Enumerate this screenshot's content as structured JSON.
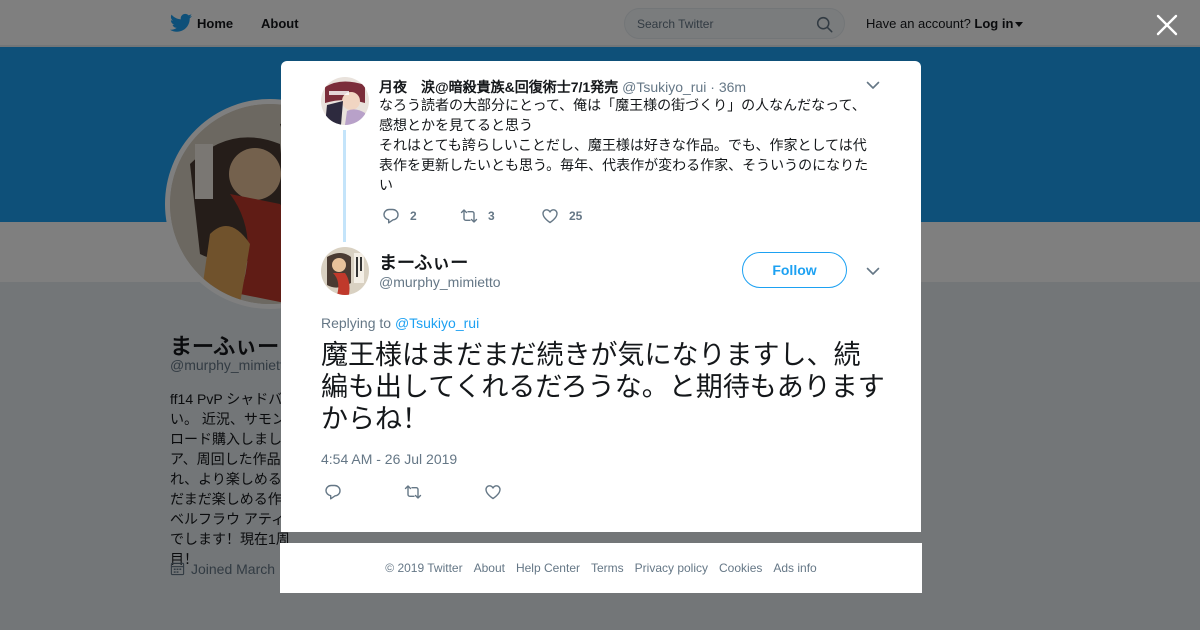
{
  "topnav": {
    "home": "Home",
    "about": "About",
    "search_placeholder": "Search Twitter",
    "have_account": "Have an account?",
    "login": "Log in"
  },
  "profile": {
    "name": "まーふぃー",
    "handle": "@murphy_mimietto",
    "bio": "ff14 PvP シャドバ\nい。 近況、サモン\nロード購入しまし\nア、周回した作品\nれ、より楽しめる\nだまだ楽しめる作\nベルフラウ アティ\nでします！現在1周目！",
    "joined": "Joined March"
  },
  "parent_tweet": {
    "name": "月夜　涙@暗殺貴族&回復術士7/1発売",
    "handle": "@Tsukiyo_rui",
    "time": "· 36m",
    "text": "なろう読者の大部分にとって、俺は「魔王様の街づくり」の人なんだなって、\n感想とかを見てると思う\nそれはとても誇らしいことだし、魔王様は好きな作品。でも、作家としては代\n表作を更新したいとも思う。毎年、代表作が変わる作家、そういうのになりた\nい",
    "replies": "2",
    "retweets": "3",
    "likes": "25"
  },
  "main_tweet": {
    "name": "まーふぃー",
    "handle": "@murphy_mimietto",
    "follow": "Follow",
    "replying_label": "Replying to",
    "replying_to": "@Tsukiyo_rui",
    "text": "魔王様はまだまだ続きが気になりますし、続編も出してくれるだろうな。と期待もありますからね！",
    "timestamp": "4:54 AM - 26 Jul 2019"
  },
  "footer": {
    "copyright": "© 2019 Twitter",
    "links": [
      "About",
      "Help Center",
      "Terms",
      "Privacy policy",
      "Cookies",
      "Ads info"
    ]
  },
  "colors": {
    "accent": "#1da1f2",
    "banner": "#1da1f2",
    "muted": "#657786",
    "text": "#14171a",
    "thread_line": "#c4e4fa"
  },
  "icons": [
    "twitter-bird-icon",
    "search-icon",
    "close-icon",
    "chevron-down-icon",
    "reply-icon",
    "retweet-icon",
    "like-icon",
    "calendar-icon"
  ]
}
